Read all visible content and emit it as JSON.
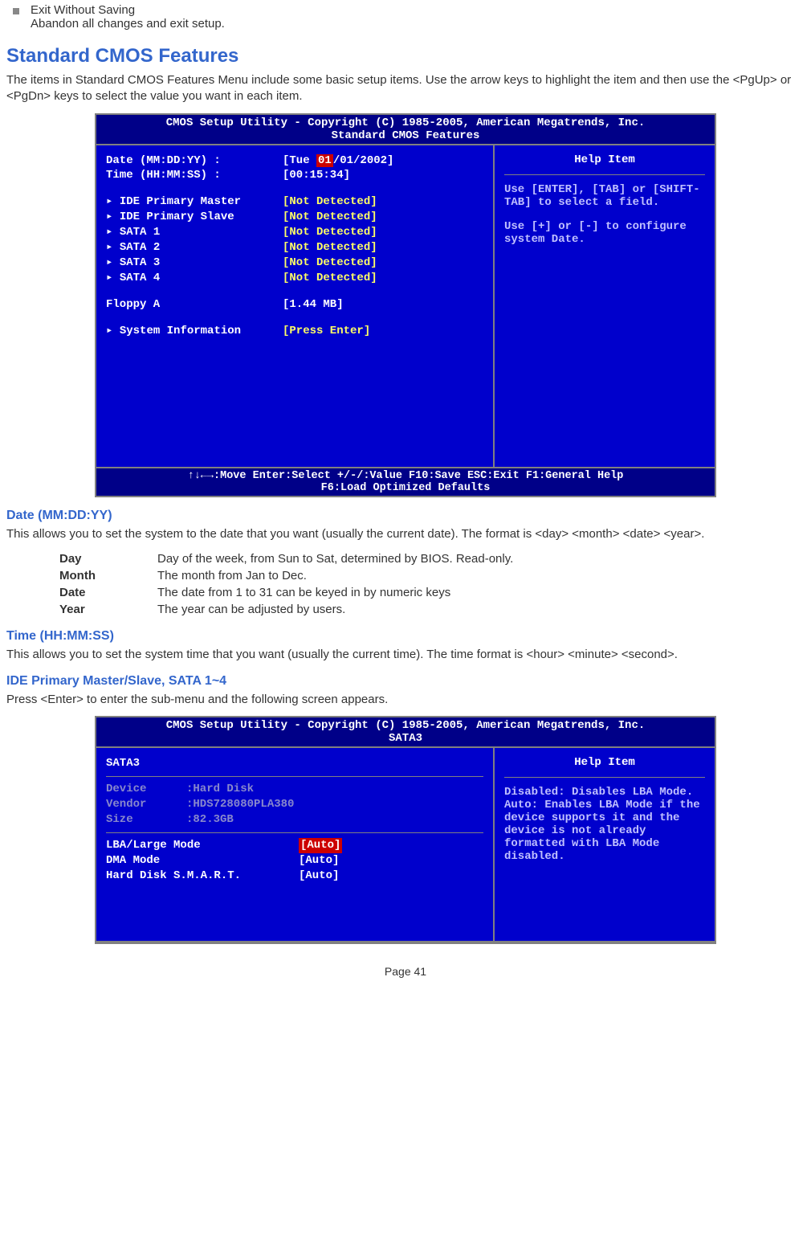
{
  "bullet": {
    "title": "Exit Without Saving",
    "desc": "Abandon all changes and exit setup."
  },
  "section1": {
    "heading": "Standard CMOS Features",
    "intro": "The items in Standard CMOS Features Menu include some basic setup items. Use the arrow keys to highlight the item and then use the <PgUp> or <PgDn> keys to select the value you want in each item."
  },
  "bios1": {
    "top": "CMOS Setup Utility - Copyright (C) 1985-2005, American Megatrends, Inc.",
    "subtitle": "Standard CMOS Features",
    "date_label": "Date (MM:DD:YY) :",
    "date_pre": "[Tue ",
    "date_sel": "01",
    "date_post": "/01/2002]",
    "time_label": "Time (HH:MM:SS) :",
    "time_val": "[00:15:34]",
    "rows": [
      {
        "label": "IDE Primary Master",
        "val": "[Not Detected]"
      },
      {
        "label": "IDE Primary Slave",
        "val": "[Not Detected]"
      },
      {
        "label": "SATA 1",
        "val": "[Not Detected]"
      },
      {
        "label": "SATA 2",
        "val": "[Not Detected]"
      },
      {
        "label": "SATA 3",
        "val": "[Not Detected]"
      },
      {
        "label": "SATA 4",
        "val": "[Not Detected]"
      }
    ],
    "floppy_label": "Floppy A",
    "floppy_val": "[1.44 MB]",
    "sysinfo_label": "System Information",
    "sysinfo_val": "[Press Enter]",
    "help_title": "Help Item",
    "help1": "Use [ENTER], [TAB] or [SHIFT-TAB] to select a field.",
    "help2": "Use [+] or [-] to configure system Date.",
    "footer1": "↑↓←→:Move  Enter:Select  +/-/:Value  F10:Save  ESC:Exit  F1:General Help",
    "footer2": "F6:Load Optimized Defaults"
  },
  "date_section": {
    "heading": "Date (MM:DD:YY)",
    "para": "This allows you to set the system to the date that you want (usually the current date). The format is <day> <month> <date> <year>.",
    "rows": [
      {
        "k": "Day",
        "v": "Day of the week, from Sun to Sat, determined by BIOS. Read-only."
      },
      {
        "k": "Month",
        "v": "The month from Jan to Dec."
      },
      {
        "k": "Date",
        "v": "The date from 1 to 31 can be keyed in by numeric keys"
      },
      {
        "k": "Year",
        "v": "The year can be adjusted by users."
      }
    ]
  },
  "time_section": {
    "heading": "Time (HH:MM:SS)",
    "para": "This allows you to set the system time that you want (usually the current time). The time format is <hour> <minute> <second>."
  },
  "ide_section": {
    "heading": "IDE Primary Master/Slave, SATA 1~4",
    "para": "Press <Enter> to enter the sub-menu and the following screen appears."
  },
  "bios2": {
    "top": "CMOS Setup Utility - Copyright (C) 1985-2005, American Megatrends, Inc.",
    "subtitle": "SATA3",
    "left_title": "SATA3",
    "info": [
      {
        "k": "Device",
        "v": ":Hard Disk"
      },
      {
        "k": "Vendor",
        "v": ":HDS728080PLA380"
      },
      {
        "k": "Size",
        "v": ":82.3GB"
      }
    ],
    "rows": [
      {
        "label": "LBA/Large Mode",
        "val": "[Auto]",
        "sel": true
      },
      {
        "label": "DMA Mode",
        "val": "[Auto]",
        "sel": false
      },
      {
        "label": "Hard Disk S.M.A.R.T.",
        "val": "[Auto]",
        "sel": false
      }
    ],
    "help_title": "Help Item",
    "help": "Disabled: Disables LBA Mode.\nAuto: Enables LBA Mode if the device supports it and the device is not already formatted with LBA Mode disabled."
  },
  "page": "Page 41"
}
